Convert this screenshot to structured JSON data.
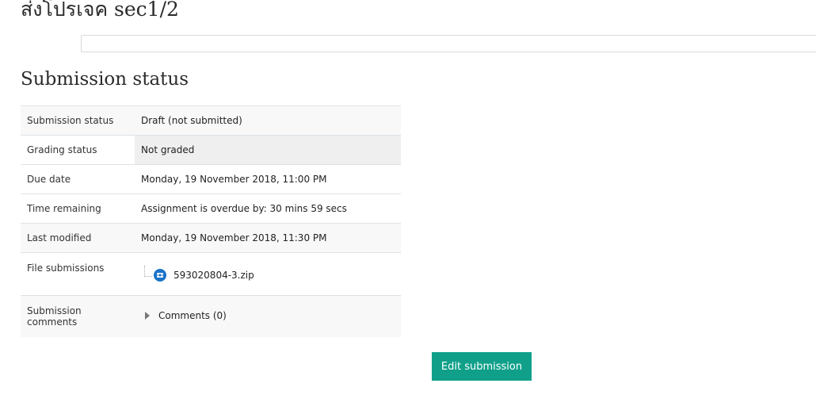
{
  "page": {
    "title": "ส่งโปรเจค sec1/2"
  },
  "submission": {
    "heading": "Submission status",
    "rows": [
      {
        "label": "Submission status",
        "value": "Draft (not submitted)"
      },
      {
        "label": "Grading status",
        "value": "Not graded"
      },
      {
        "label": "Due date",
        "value": "Monday, 19 November 2018, 11:00 PM"
      },
      {
        "label": "Time remaining",
        "value": "Assignment is overdue by: 30 mins 59 secs"
      },
      {
        "label": "Last modified",
        "value": "Monday, 19 November 2018, 11:30 PM"
      },
      {
        "label": "File submissions",
        "file": "593020804-3.zip"
      },
      {
        "label": "Submission comments",
        "comments": "Comments (0)"
      }
    ]
  },
  "actions": {
    "edit_label": "Edit submission"
  },
  "colors": {
    "overdue": "#c42020",
    "button": "#10a08a",
    "file_icon": "#1a73c8"
  },
  "icons": {
    "file": "archive-file-icon",
    "comments_toggle": "caret-right-icon"
  }
}
